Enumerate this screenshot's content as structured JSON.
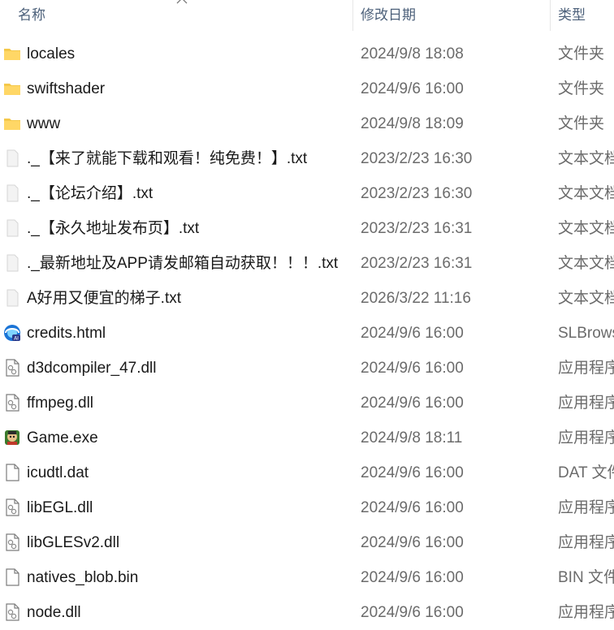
{
  "header": {
    "name": "名称",
    "date": "修改日期",
    "type": "类型"
  },
  "files": [
    {
      "name": "locales",
      "date": "2024/9/8 18:08",
      "type": "文件夹",
      "icon": "folder-icon"
    },
    {
      "name": "swiftshader",
      "date": "2024/9/6 16:00",
      "type": "文件夹",
      "icon": "folder-icon"
    },
    {
      "name": "www",
      "date": "2024/9/8 18:09",
      "type": "文件夹",
      "icon": "folder-icon"
    },
    {
      "name": "._【来了就能下载和观看！纯免费！】.txt",
      "date": "2023/2/23 16:30",
      "type": "文本文档",
      "icon": "text-file-icon"
    },
    {
      "name": "._【论坛介绍】.txt",
      "date": "2023/2/23 16:30",
      "type": "文本文档",
      "icon": "text-file-icon"
    },
    {
      "name": "._【永久地址发布页】.txt",
      "date": "2023/2/23 16:31",
      "type": "文本文档",
      "icon": "text-file-icon"
    },
    {
      "name": "._最新地址及APP请发邮箱自动获取！！！.txt",
      "date": "2023/2/23 16:31",
      "type": "文本文档",
      "icon": "text-file-icon"
    },
    {
      "name": "A好用又便宜的梯子.txt",
      "date": "2026/3/22 11:16",
      "type": "文本文档",
      "icon": "text-file-icon"
    },
    {
      "name": "credits.html",
      "date": "2024/9/6 16:00",
      "type": "SLBrows",
      "icon": "browser-icon"
    },
    {
      "name": "d3dcompiler_47.dll",
      "date": "2024/9/6 16:00",
      "type": "应用程序",
      "icon": "dll-file-icon"
    },
    {
      "name": "ffmpeg.dll",
      "date": "2024/9/6 16:00",
      "type": "应用程序",
      "icon": "dll-file-icon"
    },
    {
      "name": "Game.exe",
      "date": "2024/9/8 18:11",
      "type": "应用程序",
      "icon": "game-exe-icon"
    },
    {
      "name": "icudtl.dat",
      "date": "2024/9/6 16:00",
      "type": "DAT 文件",
      "icon": "blank-file-icon"
    },
    {
      "name": "libEGL.dll",
      "date": "2024/9/6 16:00",
      "type": "应用程序",
      "icon": "dll-file-icon"
    },
    {
      "name": "libGLESv2.dll",
      "date": "2024/9/6 16:00",
      "type": "应用程序",
      "icon": "dll-file-icon"
    },
    {
      "name": "natives_blob.bin",
      "date": "2024/9/6 16:00",
      "type": "BIN 文件",
      "icon": "blank-file-icon"
    },
    {
      "name": "node.dll",
      "date": "2024/9/6 16:00",
      "type": "应用程序",
      "icon": "dll-file-icon"
    }
  ]
}
